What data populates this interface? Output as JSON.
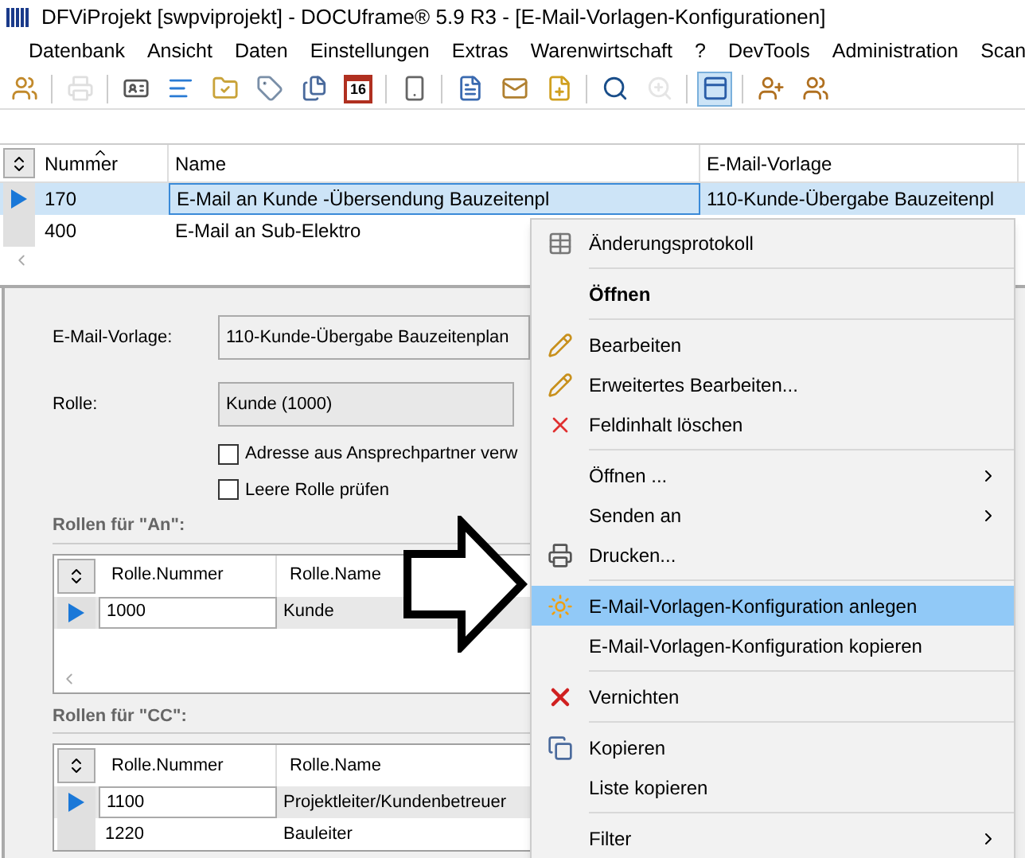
{
  "window": {
    "title": "DFViProjekt [swpviprojekt] - DOCUframe® 5.9 R3 - [E-Mail-Vorlagen-Konfigurationen]"
  },
  "menu_bar": [
    "Datenbank",
    "Ansicht",
    "Daten",
    "Einstellungen",
    "Extras",
    "Warenwirtschaft",
    "?",
    "DevTools",
    "Administration",
    "Scan"
  ],
  "toolbar": [
    {
      "kind": "button",
      "disabled": false,
      "selected": false
    },
    {
      "kind": "separator"
    },
    {
      "kind": "button",
      "disabled": true,
      "selected": false
    },
    {
      "kind": "separator"
    },
    {
      "kind": "button",
      "disabled": false,
      "selected": false
    },
    {
      "kind": "button",
      "disabled": false,
      "selected": false
    },
    {
      "kind": "button",
      "disabled": false,
      "selected": false
    },
    {
      "kind": "button",
      "disabled": false,
      "selected": false
    },
    {
      "kind": "button",
      "disabled": false,
      "selected": false
    },
    {
      "kind": "calendar",
      "disabled": false,
      "selected": false,
      "label": "16"
    },
    {
      "kind": "separator"
    },
    {
      "kind": "button",
      "disabled": false,
      "selected": false
    },
    {
      "kind": "separator"
    },
    {
      "kind": "button",
      "disabled": false,
      "selected": false
    },
    {
      "kind": "button",
      "disabled": false,
      "selected": false
    },
    {
      "kind": "button",
      "disabled": false,
      "selected": false
    },
    {
      "kind": "separator"
    },
    {
      "kind": "button",
      "disabled": false,
      "selected": false
    },
    {
      "kind": "button",
      "disabled": true,
      "selected": false
    },
    {
      "kind": "separator"
    },
    {
      "kind": "button",
      "disabled": false,
      "selected": true
    },
    {
      "kind": "separator"
    },
    {
      "kind": "button",
      "disabled": false,
      "selected": false
    },
    {
      "kind": "button",
      "disabled": false,
      "selected": false
    }
  ],
  "table": {
    "columns": [
      "Nummer",
      "Name",
      "E-Mail-Vorlage"
    ],
    "rows": [
      {
        "selected": true,
        "cells": [
          "170",
          "E-Mail an Kunde -Übersendung Bauzeitenpl",
          "110-Kunde-Übergabe Bauzeitenpl"
        ]
      },
      {
        "selected": false,
        "cells": [
          "400",
          "E-Mail an Sub-Elektro",
          ""
        ]
      }
    ]
  },
  "details": {
    "vorlage_label": "E-Mail-Vorlage:",
    "vorlage_value": "110-Kunde-Übergabe Bauzeitenplan",
    "rolle_label": "Rolle:",
    "rolle_value": "Kunde (1000)",
    "checkboxes": [
      {
        "label": "Adresse aus Ansprechpartner verw",
        "checked": false
      },
      {
        "label": "Leere Rolle prüfen",
        "checked": false
      }
    ]
  },
  "grids": [
    {
      "title": "Rollen für \"An\":",
      "columns": [
        "Rolle.Nummer",
        "Rolle.Name"
      ],
      "rows": [
        {
          "selected": true,
          "cells": [
            "1000",
            "Kunde"
          ]
        }
      ]
    },
    {
      "title": "Rollen für \"CC\":",
      "columns": [
        "Rolle.Nummer",
        "Rolle.Name"
      ],
      "rows": [
        {
          "selected": true,
          "cells": [
            "1100",
            "Projektleiter/Kundenbetreuer"
          ]
        },
        {
          "selected": false,
          "cells": [
            "1220",
            "Bauleiter"
          ]
        }
      ]
    }
  ],
  "context_menu": [
    {
      "kind": "item",
      "label": "Änderungsprotokoll",
      "selected": false
    },
    {
      "kind": "separator"
    },
    {
      "kind": "bold",
      "label": "Öffnen",
      "selected": false
    },
    {
      "kind": "separator"
    },
    {
      "kind": "item",
      "label": "Bearbeiten",
      "selected": false
    },
    {
      "kind": "item",
      "label": "Erweitertes Bearbeiten...",
      "selected": false
    },
    {
      "kind": "item",
      "label": "Feldinhalt löschen",
      "selected": false
    },
    {
      "kind": "separator"
    },
    {
      "kind": "submenu",
      "label": "Öffnen ...",
      "selected": false
    },
    {
      "kind": "submenu",
      "label": "Senden an",
      "selected": false
    },
    {
      "kind": "item",
      "label": "Drucken...",
      "selected": false
    },
    {
      "kind": "separator"
    },
    {
      "kind": "item",
      "label": "E-Mail-Vorlagen-Konfiguration anlegen",
      "selected": true
    },
    {
      "kind": "item",
      "label": "E-Mail-Vorlagen-Konfiguration kopieren",
      "selected": false
    },
    {
      "kind": "separator"
    },
    {
      "kind": "item",
      "label": "Vernichten",
      "selected": false
    },
    {
      "kind": "separator"
    },
    {
      "kind": "item",
      "label": "Kopieren",
      "selected": false
    },
    {
      "kind": "item",
      "label": "Liste kopieren",
      "selected": false
    },
    {
      "kind": "separator"
    },
    {
      "kind": "submenu",
      "label": "Filter",
      "selected": false
    }
  ]
}
